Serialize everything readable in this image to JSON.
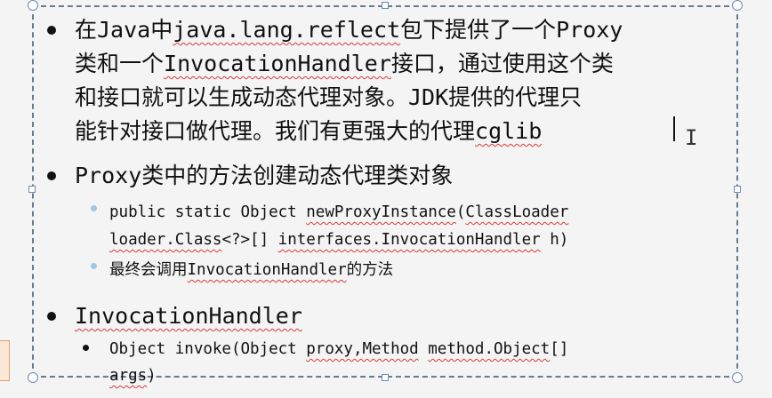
{
  "slide": {
    "line1": {
      "a": "在Java中",
      "b": "java.lang.reflect",
      "c": "包下提供了一个Proxy"
    },
    "line2": {
      "a": "类和一个",
      "b": "InvocationHandler",
      "c": "接口，通过使用这个类"
    },
    "line3": {
      "a": "和接口就可以生成动态代理对象。JDK提供的代理只"
    },
    "line4": {
      "a": "能针对接口做代理。我们有更强大的代理",
      "b": "cglib"
    },
    "line5": {
      "a": "Proxy类中的方法创建动态代理类对象"
    },
    "sub1a": {
      "a": "public static Object ",
      "b": "newProxyInstance",
      "c": "(",
      "d": "ClassLoader"
    },
    "sub1b": {
      "a": "loader.Class",
      "b": "<?>[] ",
      "c": "interfaces.InvocationHandler",
      "d": " h)"
    },
    "sub2": {
      "a": "最终会调用",
      "b": "InvocationHandler",
      "c": "的方法"
    },
    "line6": {
      "a": "InvocationHandler"
    },
    "sub3a": {
      "a": "Object invoke(Object ",
      "b": "proxy,Method",
      "c": " ",
      "d": "method.Object",
      "e": "[]"
    },
    "sub3b": {
      "a": "args",
      "b": ")"
    },
    "ibeam_glyph": "I"
  },
  "colors": {
    "spell_underline": "#d93a3a",
    "sub_bullet": "#9ec7e8",
    "textbox_border": "#6b7a8c",
    "handle_border": "#6d89b3"
  }
}
